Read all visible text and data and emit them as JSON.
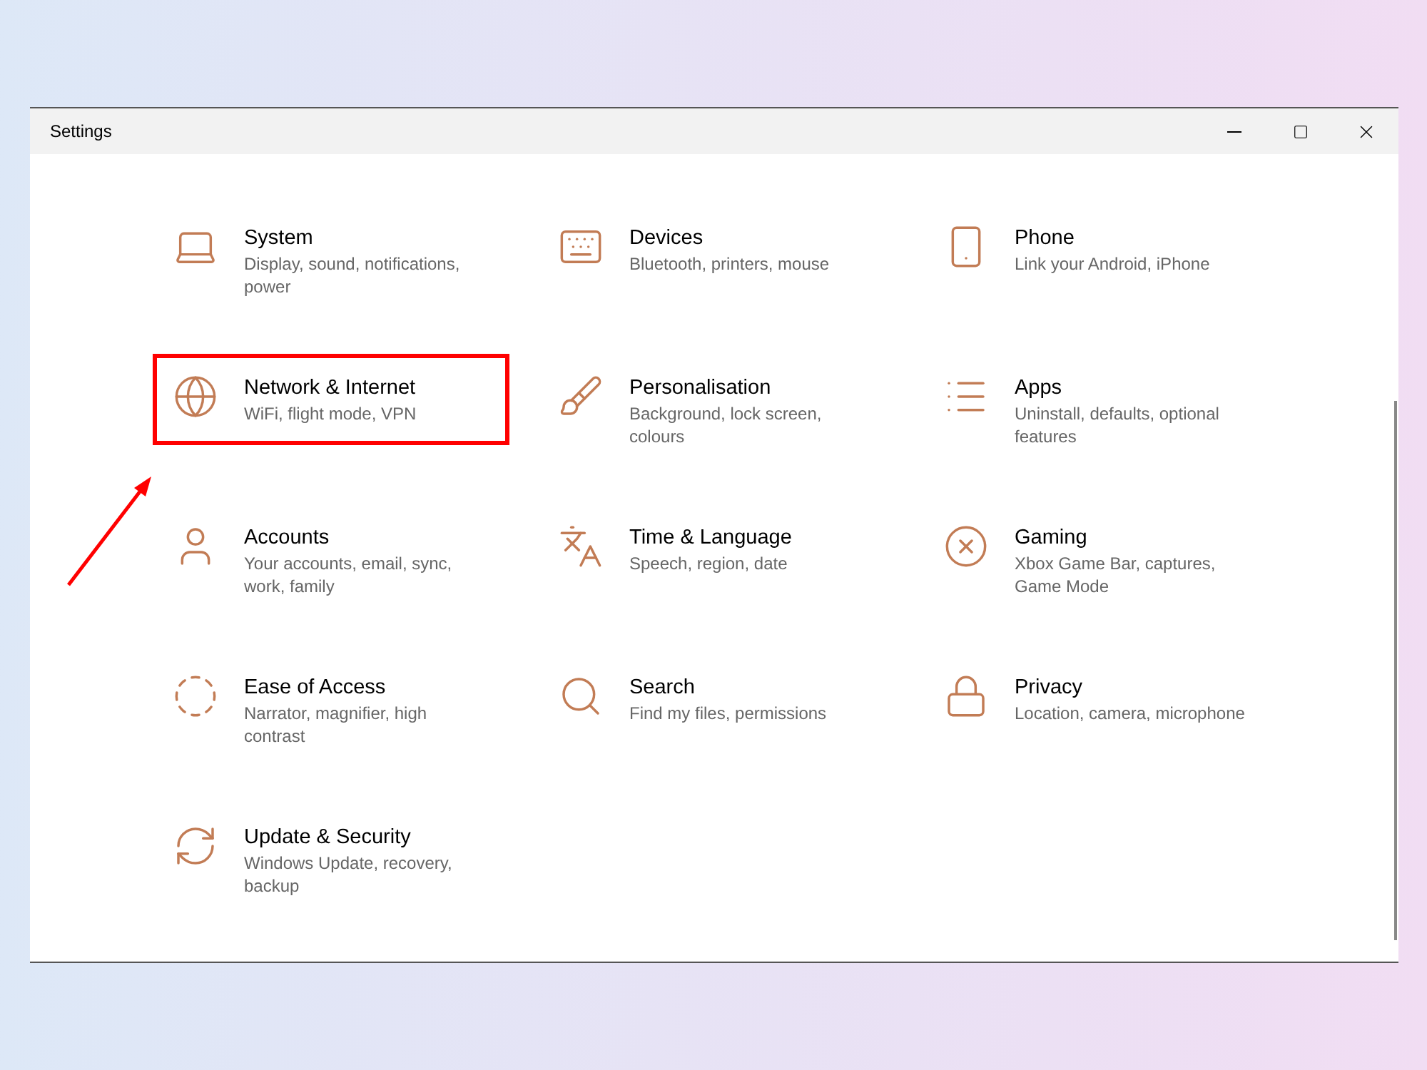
{
  "window": {
    "title": "Settings"
  },
  "items": [
    {
      "title": "System",
      "description": "Display, sound, notifications, power",
      "highlighted": false
    },
    {
      "title": "Devices",
      "description": "Bluetooth, printers, mouse",
      "highlighted": false
    },
    {
      "title": "Phone",
      "description": "Link your Android, iPhone",
      "highlighted": false
    },
    {
      "title": "Network & Internet",
      "description": "WiFi, flight mode, VPN",
      "highlighted": true
    },
    {
      "title": "Personalisation",
      "description": "Background, lock screen, colours",
      "highlighted": false
    },
    {
      "title": "Apps",
      "description": "Uninstall, defaults, optional features",
      "highlighted": false
    },
    {
      "title": "Accounts",
      "description": "Your accounts, email, sync, work, family",
      "highlighted": false
    },
    {
      "title": "Time & Language",
      "description": "Speech, region, date",
      "highlighted": false
    },
    {
      "title": "Gaming",
      "description": "Xbox Game Bar, captures, Game Mode",
      "highlighted": false
    },
    {
      "title": "Ease of Access",
      "description": "Narrator, magnifier, high contrast",
      "highlighted": false
    },
    {
      "title": "Search",
      "description": "Find my files, permissions",
      "highlighted": false
    },
    {
      "title": "Privacy",
      "description": "Location, camera, microphone",
      "highlighted": false
    },
    {
      "title": "Update & Security",
      "description": "Windows Update, recovery, backup",
      "highlighted": false
    }
  ]
}
